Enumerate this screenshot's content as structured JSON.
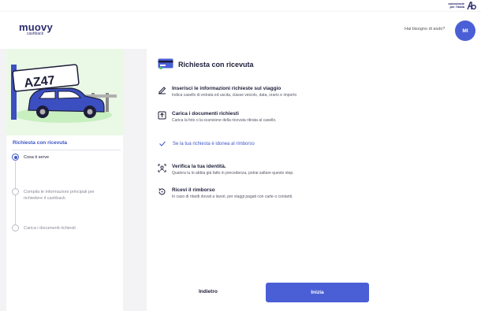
{
  "topbar": {
    "partner_line1": "autostrade",
    "partner_line2": "per l'italia"
  },
  "header": {
    "logo_main": "muovy",
    "logo_sub": "cashback",
    "help_text": "Hai bisogno di aiuto?",
    "avatar_initials": "MI"
  },
  "sidebar": {
    "plate_text": "AZ47",
    "title": "Richiesta con ricevuta",
    "steps": [
      {
        "label": "Cosa ti serve"
      },
      {
        "label_line1": "Compila le informazioni principali per",
        "label_line2": "richiedere il cashback"
      },
      {
        "label": "Carica i documenti richiesti"
      }
    ]
  },
  "main": {
    "title": "Richiesta con ricevuta",
    "items": [
      {
        "title": "Inserisci le informazioni richieste sul viaggio",
        "desc": "Indica casello di entrata ed uscita, classe veicolo, data, orario e importo"
      },
      {
        "title": "Carica i documenti richiesti",
        "desc": "Carica la foto o la scansione della ricevuta ritirata al casello."
      },
      {
        "title": "Verifica la tua identità.",
        "desc": "Qualora tu lo abbia già fatto in precedenza, potrai saltare questo step."
      },
      {
        "title": "Ricevi il rimborso",
        "desc": "In caso di ritardi dovuti a lavori, per viaggi pagati con carte o contanti."
      }
    ],
    "check_text": "Se la tua richiesta è idonea al rimborso",
    "back_label": "Indietro",
    "start_label": "Inizia"
  },
  "colors": {
    "accent": "#4a5fd6",
    "link": "#3d55c8",
    "illustration_bg": "#eaf8e6"
  },
  "icons": [
    "aspi-logo-icon",
    "card-receipt-icon",
    "edit-icon",
    "upload-icon",
    "check-icon",
    "identity-icon",
    "refund-icon"
  ]
}
